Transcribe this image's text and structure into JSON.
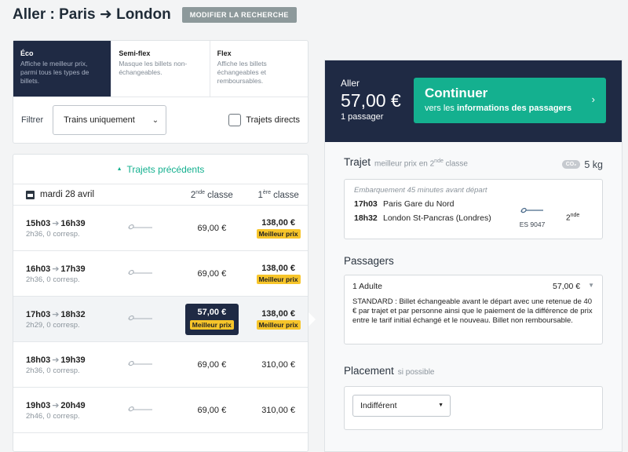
{
  "header": {
    "title": "Aller : Paris ➜ London",
    "modify_button": "MODIFIER LA RECHERCHE"
  },
  "fares": [
    {
      "name": "Éco",
      "desc": "Affiche le meilleur prix, parmi tous les types de billets.",
      "active": true
    },
    {
      "name": "Semi-flex",
      "desc": "Masque les billets non-échangeables.",
      "active": false
    },
    {
      "name": "Flex",
      "desc": "Affiche les billets échangeables et remboursables.",
      "active": false
    }
  ],
  "filter": {
    "label": "Filtrer",
    "select_value": "Trains uniquement",
    "direct_label": "Trajets directs"
  },
  "results": {
    "previous": "Trajets précédents",
    "date": "mardi 28 avril",
    "col2_prefix": "2",
    "col2_sup": "nde",
    "col2_suffix": " classe",
    "col1_prefix": "1",
    "col1_sup": "ère",
    "col1_suffix": " classe",
    "best_label": "Meilleur prix",
    "rows": [
      {
        "dep": "15h03",
        "arr": "16h39",
        "details": "2h36, 0 corresp.",
        "p2": "69,00 €",
        "p1": "138,00 €",
        "p1_best": true,
        "p2_best": false,
        "selected": false
      },
      {
        "dep": "16h03",
        "arr": "17h39",
        "details": "2h36, 0 corresp.",
        "p2": "69,00 €",
        "p1": "138,00 €",
        "p1_best": true,
        "p2_best": false,
        "selected": false
      },
      {
        "dep": "17h03",
        "arr": "18h32",
        "details": "2h29, 0 corresp.",
        "p2": "57,00 €",
        "p1": "138,00 €",
        "p1_best": true,
        "p2_best": true,
        "selected": true
      },
      {
        "dep": "18h03",
        "arr": "19h39",
        "details": "2h36, 0 corresp.",
        "p2": "69,00 €",
        "p1": "310,00 €",
        "p1_best": false,
        "p2_best": false,
        "selected": false
      },
      {
        "dep": "19h03",
        "arr": "20h49",
        "details": "2h46, 0 corresp.",
        "p2": "69,00 €",
        "p1": "310,00 €",
        "p1_best": false,
        "p2_best": false,
        "selected": false
      }
    ]
  },
  "summary": {
    "label": "Aller",
    "amount": "57,00 €",
    "passengers": "1 passager",
    "continue_main": "Continuer",
    "continue_sub_prefix": "vers les ",
    "continue_sub_bold": "informations des passagers"
  },
  "trajet": {
    "title": "Trajet",
    "sub_prefix": "meilleur prix en 2",
    "sub_sup": "nde",
    "sub_suffix": " classe",
    "co2_badge": "CO₂",
    "co2_value": "5 kg",
    "boarding": "Embarquement 45 minutes avant départ",
    "dep_time": "17h03",
    "dep_station": "Paris Gare du Nord",
    "arr_time": "18h32",
    "arr_station": "London St-Pancras (Londres)",
    "train_number": "ES 9047",
    "class_num": "2",
    "class_sup": "nde"
  },
  "passagers": {
    "title": "Passagers",
    "count": "1 Adulte",
    "price": "57,00 €",
    "desc": "STANDARD : Billet échangeable avant le départ avec une retenue de 40 € par trajet et par personne ainsi que le paiement de la différence de prix entre le tarif initial échangé et le nouveau. Billet non remboursable."
  },
  "placement": {
    "title": "Placement",
    "sub": "si possible",
    "value": "Indifférent"
  }
}
